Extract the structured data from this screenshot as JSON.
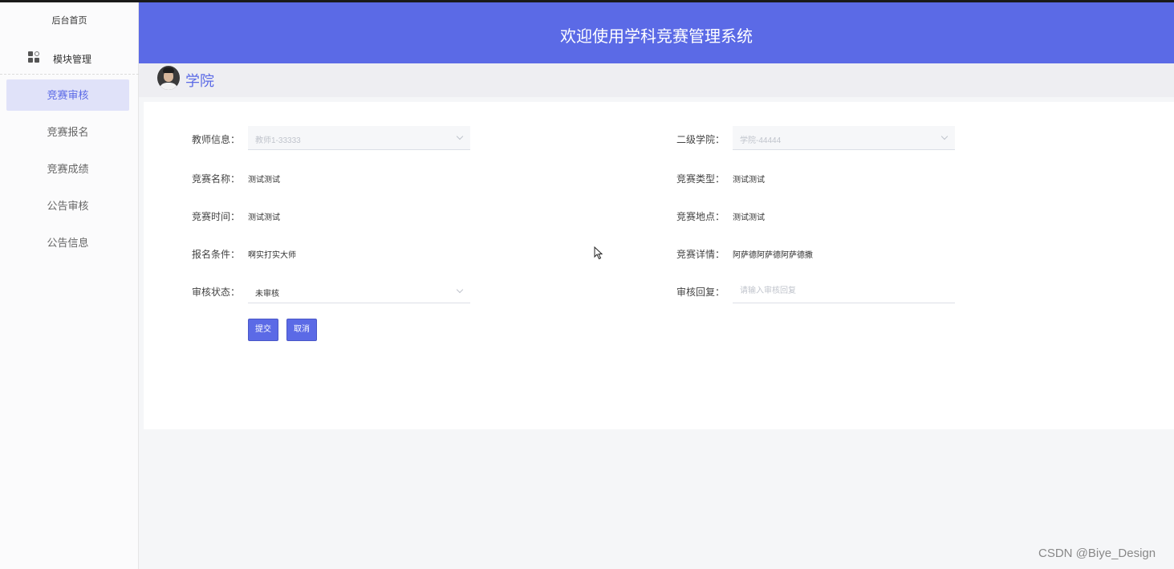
{
  "sidebar": {
    "home": "后台首页",
    "module": {
      "icon": "apps-icon",
      "label": "模块管理"
    },
    "items": [
      {
        "label": "竞赛审核",
        "active": true
      },
      {
        "label": "竞赛报名",
        "active": false
      },
      {
        "label": "竞赛成绩",
        "active": false
      },
      {
        "label": "公告审核",
        "active": false
      },
      {
        "label": "公告信息",
        "active": false
      }
    ]
  },
  "header": {
    "title": "欢迎使用学科竞赛管理系统"
  },
  "subbar": {
    "role": "学院",
    "avatar": "user-avatar"
  },
  "form": {
    "teacher": {
      "label": "教师信息：",
      "value": "教师1-33333"
    },
    "college": {
      "label": "二级学院：",
      "value": "学院-44444"
    },
    "comp_name": {
      "label": "竞赛名称：",
      "value": "测试测试"
    },
    "comp_type": {
      "label": "竞赛类型：",
      "value": "测试测试"
    },
    "comp_time": {
      "label": "竞赛时间：",
      "value": "测试测试"
    },
    "comp_place": {
      "label": "竞赛地点：",
      "value": "测试测试"
    },
    "conditions": {
      "label": "报名条件：",
      "value": "啊实打实大师"
    },
    "details": {
      "label": "竞赛详情：",
      "value": "阿萨德阿萨德阿萨德撒"
    },
    "status": {
      "label": "审核状态：",
      "value": "未审核"
    },
    "reply": {
      "label": "审核回复：",
      "placeholder": "请输入审核回复",
      "value": ""
    },
    "submit": "提交",
    "cancel": "取消"
  },
  "watermark": "CSDN @Biye_Design",
  "colors": {
    "accent": "#5b6ae6",
    "active_bg": "#e0e2f9"
  }
}
